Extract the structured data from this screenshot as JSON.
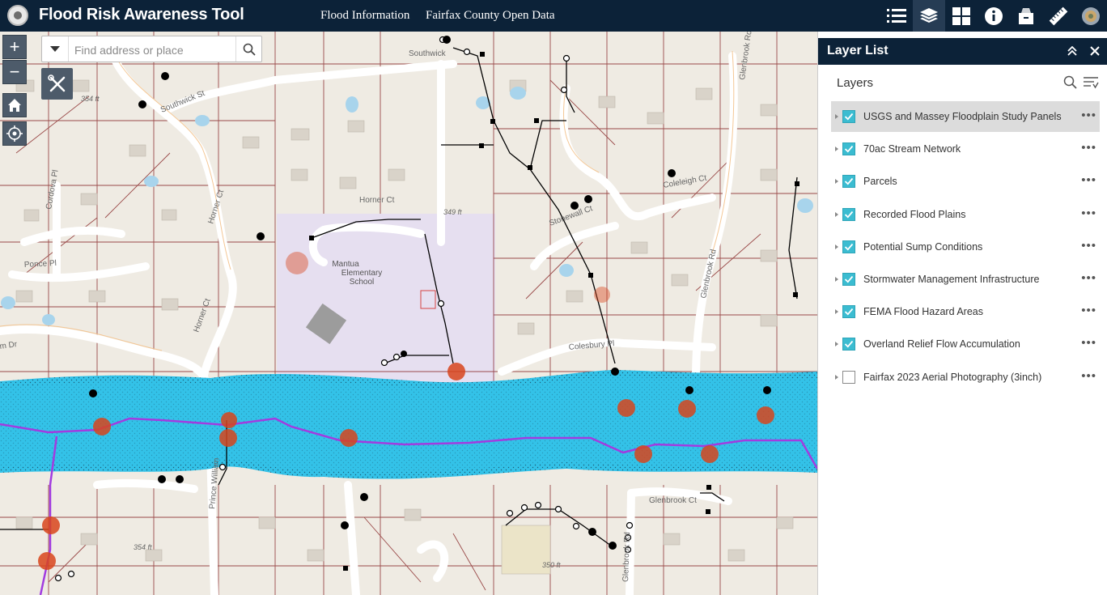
{
  "header": {
    "title": "Flood Risk Awareness Tool",
    "links": [
      "Flood Information",
      "Fairfax County Open Data"
    ],
    "toolbar_icons": [
      "list-icon",
      "layers-icon",
      "basemap-gallery-icon",
      "info-icon",
      "print-icon",
      "measure-icon",
      "globe-icon"
    ]
  },
  "search": {
    "placeholder": "Find address or place",
    "value": ""
  },
  "map": {
    "zoom_in": "+",
    "zoom_out": "−",
    "labels": {
      "school": [
        "Mantua",
        "Elementary",
        "School"
      ],
      "horner_ct": "Horner Ct",
      "horner_ct_2": "Horner Ct",
      "horner_ct_3": "Horner Ct",
      "southwick": "Southwick",
      "southwick_st": "Southwick St",
      "stonewall": "Stonewall Ct",
      "cordova": "Cordova Pl",
      "ponce": "Ponce Pl",
      "glenbrook_rd": "Glenbrook Rd",
      "glenbrook_rd_2": "Glenbrook Rd",
      "glenbrook_rd_3": "Glenbrook Rd",
      "glenbrook_ct": "Glenbrook Ct",
      "coleleigh": "Coleleigh Ct",
      "colesbury": "Colesbury Pl",
      "prince_william": "Prince William",
      "elev_354": "354 ft",
      "elev_349": "349 ft",
      "elev_354b": "354 ft",
      "elev_350": "350 ft",
      "dr_label": "m Dr"
    }
  },
  "layer_panel": {
    "title": "Layer List",
    "subtitle": "Layers",
    "layers": [
      {
        "name": "USGS and Massey Floodplain Study Panels",
        "checked": true,
        "selected": true
      },
      {
        "name": "70ac Stream Network",
        "checked": true
      },
      {
        "name": "Parcels",
        "checked": true
      },
      {
        "name": "Recorded Flood Plains",
        "checked": true
      },
      {
        "name": "Potential Sump Conditions",
        "checked": true
      },
      {
        "name": "Stormwater Management Infrastructure",
        "checked": true
      },
      {
        "name": "FEMA Flood Hazard Areas",
        "checked": true
      },
      {
        "name": "Overland Relief Flow Accumulation",
        "checked": true
      },
      {
        "name": "Fairfax 2023 Aerial Photography (3inch)",
        "checked": false
      }
    ]
  },
  "colors": {
    "header_bg": "#0c2238",
    "flood_zone": "#33c2e8",
    "stream": "#a23be0",
    "parcel_line": "#8c2f2f",
    "checkbox": "#3bbcd1"
  }
}
